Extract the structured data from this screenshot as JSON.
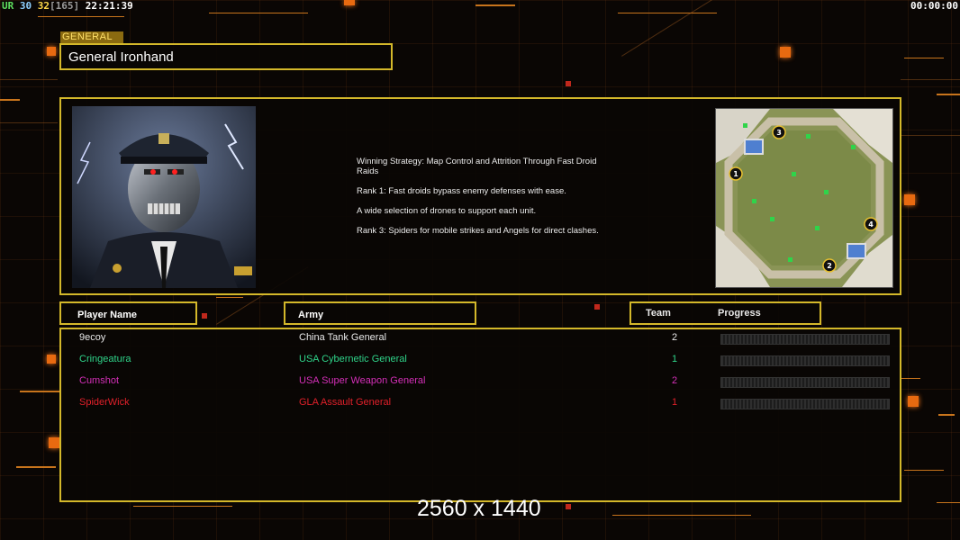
{
  "hud": {
    "left_a": "UR",
    "left_b": "30",
    "left_c": "32",
    "left_d": "[165]",
    "clock": "22:21:39",
    "timer": "00:00:00"
  },
  "general": {
    "tag": "GENERAL",
    "name": "General Ironhand",
    "portrait_icon": "cyborg-officer-portrait",
    "strategy": [
      "Winning Strategy: Map Control and Attrition Through Fast Droid Raids",
      "Rank 1: Fast droids bypass enemy defenses with ease.",
      "A wide selection of drones to support each unit.",
      "Rank 3: Spiders for mobile strikes and Angels for direct clashes."
    ]
  },
  "map": {
    "icon": "octagon-map-preview",
    "start_positions": [
      "1",
      "2",
      "3",
      "4"
    ]
  },
  "table": {
    "headers": {
      "player": "Player Name",
      "army": "Army",
      "team": "Team",
      "progress": "Progress"
    },
    "rows": [
      {
        "name": "9ecoy",
        "army": "China Tank General",
        "team": "2",
        "color": "#e8e8e8"
      },
      {
        "name": "Cringeatura",
        "army": "USA Cybernetic General",
        "team": "1",
        "color": "#2fd48a"
      },
      {
        "name": "Cumshot",
        "army": "USA Super Weapon General",
        "team": "2",
        "color": "#d42fb8"
      },
      {
        "name": "SpiderWick",
        "army": "GLA Assault General",
        "team": "1",
        "color": "#e0202a"
      }
    ]
  },
  "watermark": "2560 x 1440",
  "colors": {
    "frame": "#d4b82a",
    "accent": "#e86a10",
    "background": "#0a0604"
  }
}
